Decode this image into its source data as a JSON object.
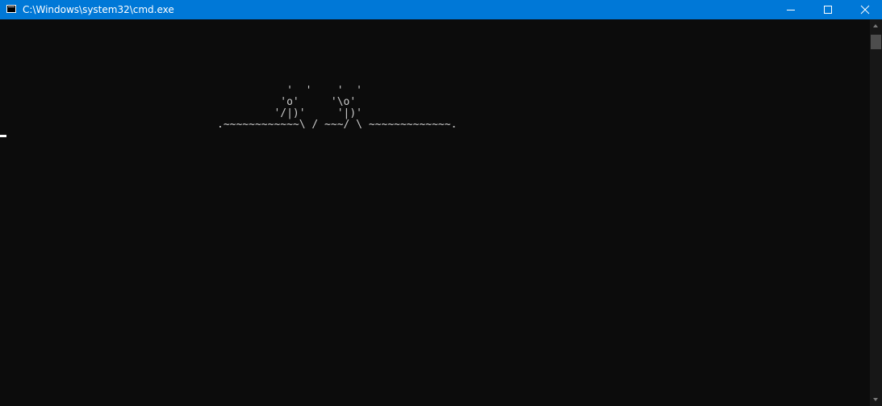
{
  "window": {
    "title": "C:\\Windows\\system32\\cmd.exe",
    "icon": "cmd-icon"
  },
  "titlebar_buttons": {
    "minimize": "minimize-icon",
    "maximize": "maximize-icon",
    "close": "close-icon"
  },
  "console": {
    "ascii_art": "           '  '    '  '\n          'o'     '\\o'\n         '/|)'     '|)'\n.~~~~~~~~~~~~\\ / ~~~/ \\ ~~~~~~~~~~~~~."
  },
  "colors": {
    "titlebar": "#0078d7",
    "console_bg": "#0c0c0c",
    "console_fg": "#cccccc"
  }
}
